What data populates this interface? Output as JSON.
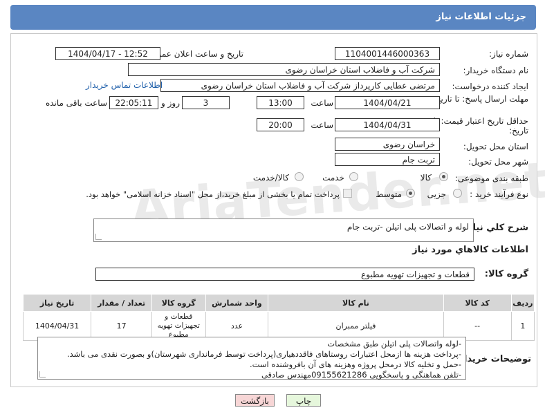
{
  "header_title": "جزئیات اطلاعات نیاز",
  "labels": {
    "need_number": "شماره نیاز:",
    "announce_datetime": "تاریخ و ساعت اعلان عمومی:",
    "buyer_org": "نام دستگاه خریدار:",
    "requester": "ایجاد کننده درخواست:",
    "reply_deadline": "مهلت ارسال پاسخ: تا تاریخ:",
    "price_validity": "حداقل تاریخ اعتبار قیمت: تا تاریخ:",
    "delivery_province": "استان محل تحویل:",
    "delivery_city": "شهر محل تحویل:",
    "category": "طبقه بندی موضوعی:",
    "purchase_process": "نوع فرآیند خرید :",
    "time_label": "ساعت",
    "time_label2": "ساعت",
    "day_label": "روز و",
    "remaining_label": "ساعت باقی مانده",
    "need_description": "شرح كلي نياز:",
    "goods_info": "اطلاعات كالاهاي مورد نياز",
    "goods_group": "گروه كالا:",
    "buyer_notes": "توضیحات خریدار:"
  },
  "values": {
    "need_number": "1104001446000363",
    "announce_datetime": "1404/04/17 - 12:52",
    "buyer_org": "شرکت آب و فاضلاب استان خراسان رضوی",
    "requester": "مرتضی عطایی کارپرداز شرکت آب و فاضلاب استان خراسان رضوی",
    "contact_link": "اطلاعات تماس خریدار",
    "reply_date": "1404/04/21",
    "reply_time": "13:00",
    "reply_days": "3",
    "reply_remaining": "22:05:11",
    "validity_date": "1404/04/31",
    "validity_time": "20:00",
    "province": "خراسان رضوی",
    "city": "تربت جام",
    "need_description": "لوله و اتصالات پلی اتیلن -تربت جام",
    "goods_group": "قطعات و تجهیزات تهویه مطبوع"
  },
  "category_options": [
    {
      "label": "کالا",
      "selected": true
    },
    {
      "label": "خدمت",
      "selected": false
    },
    {
      "label": "کالا/خدمت",
      "selected": false
    }
  ],
  "process_options": [
    {
      "label": "جزیی",
      "selected": false
    },
    {
      "label": "متوسط",
      "selected": true
    }
  ],
  "process_note": "پرداخت تمام یا بخشی از مبلغ خرید،از محل \"اسناد خزانه اسلامی\" خواهد بود.",
  "watermark": "AriaTender.net",
  "table": {
    "headers": [
      "ردیف",
      "کد کالا",
      "نام کالا",
      "واحد شمارش",
      "گروه کالا",
      "تعداد / مقدار",
      "تاریخ نیاز"
    ],
    "rows": [
      [
        "1",
        "--",
        "فیلتر ممبران",
        "عدد",
        "قطعات و تجهیزات تهویه مطبوع",
        "17",
        "1404/04/31"
      ]
    ]
  },
  "buyer_notes_lines": [
    "-لوله واتصالات پلی اتیلن طبق مشخصات",
    "-پرداخت هزینه ها ازمحل اعتبارات روستاهای فاقددهیاری(پرداخت توسط فرمانداری شهرستان)و بصورت نقدی می باشد.",
    "-حمل و تخلیه کالا درمحل پروژه وهزینه های آن بافروشنده است.",
    "-تلفن هماهنگی و پاسخگویی 09155621286مهندس صادقی"
  ],
  "buttons": {
    "print": "چاپ",
    "back": "بازگشت"
  },
  "colors": {
    "header_bg": "#5a86c2",
    "link": "#1f5faa",
    "back_btn_bg": "#f7d6d6",
    "print_btn_bg": "#e6f7dc"
  }
}
